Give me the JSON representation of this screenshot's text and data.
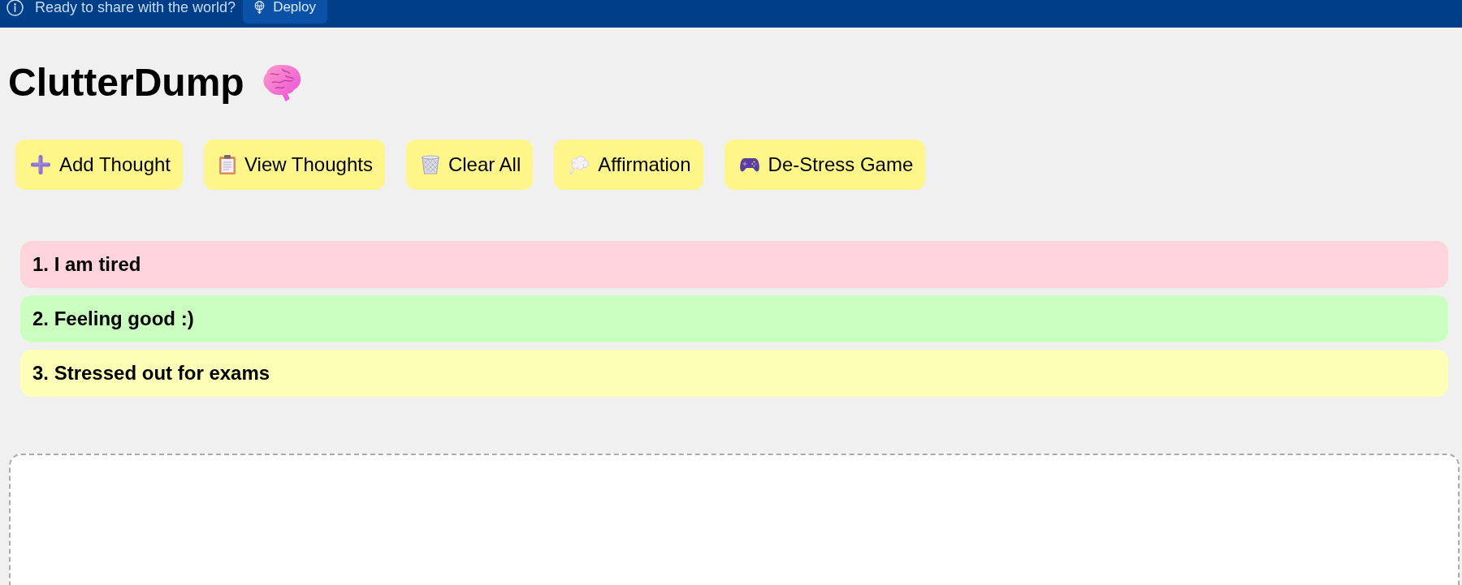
{
  "banner": {
    "message": "Ready to share with the world?",
    "button": "Deploy"
  },
  "title": "ClutterDump",
  "toolbar": [
    {
      "kind": "add",
      "label": "Add Thought"
    },
    {
      "kind": "view",
      "label": "View Thoughts"
    },
    {
      "kind": "clear",
      "label": "Clear All"
    },
    {
      "kind": "affirmation",
      "label": "Affirmation"
    },
    {
      "kind": "game",
      "label": "De-Stress Game"
    }
  ],
  "thoughts": [
    {
      "text": "1. I am tired",
      "color": "#ffd4dc"
    },
    {
      "text": "2. Feeling good :)",
      "color": "#caffc0"
    },
    {
      "text": "3. Stressed out for exams",
      "color": "#fdffb6"
    }
  ]
}
